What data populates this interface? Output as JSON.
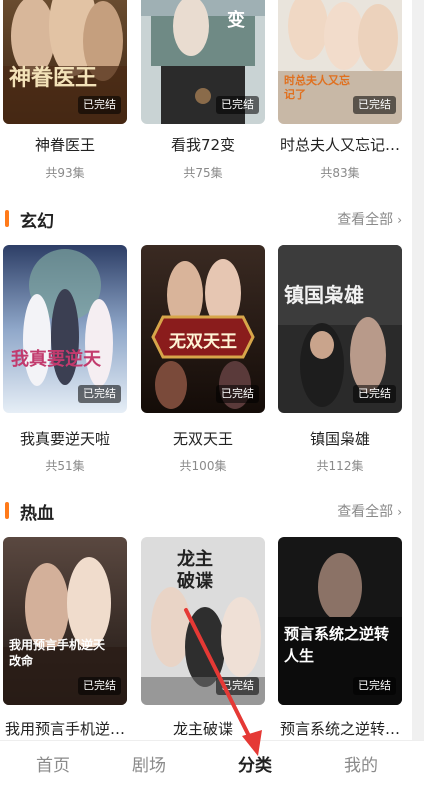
{
  "sections": [
    {
      "title": "",
      "view_all": "",
      "cards": [
        {
          "title": "神眷医王",
          "count": "共93集",
          "status": "已完结",
          "cover_text": "神眷医王"
        },
        {
          "title": "看我72变",
          "count": "共75集",
          "status": "已完结",
          "cover_text": "变"
        },
        {
          "title": "时总夫人又忘记…",
          "count": "共83集",
          "status": "已完结",
          "cover_text": "时总夫人又忘记了"
        }
      ]
    },
    {
      "title": "玄幻",
      "view_all": "查看全部",
      "cards": [
        {
          "title": "我真要逆天啦",
          "count": "共51集",
          "status": "已完结",
          "cover_text": "我真要逆天"
        },
        {
          "title": "无双天王",
          "count": "共100集",
          "status": "已完结",
          "cover_text": "无双天王"
        },
        {
          "title": "镇国枭雄",
          "count": "共112集",
          "status": "已完结",
          "cover_text": "镇国枭雄"
        }
      ]
    },
    {
      "title": "热血",
      "view_all": "查看全部",
      "cards": [
        {
          "title": "我用预言手机逆…",
          "count": "",
          "status": "已完结",
          "cover_text": "我用预言手机逆天改命"
        },
        {
          "title": "龙主破谍",
          "count": "",
          "status": "已完结",
          "cover_text": "龙主破谍"
        },
        {
          "title": "预言系统之逆转…",
          "count": "",
          "status": "已完结",
          "cover_text": "预言系统之逆转人生"
        }
      ]
    }
  ],
  "nav": {
    "items": [
      "首页",
      "剧场",
      "分类",
      "我的"
    ],
    "active_index": 2
  },
  "colors": {
    "accent": "#ff7a1a",
    "annotation_arrow": "#e53935"
  },
  "icons": {
    "view_all": "chevron-right-icon"
  }
}
